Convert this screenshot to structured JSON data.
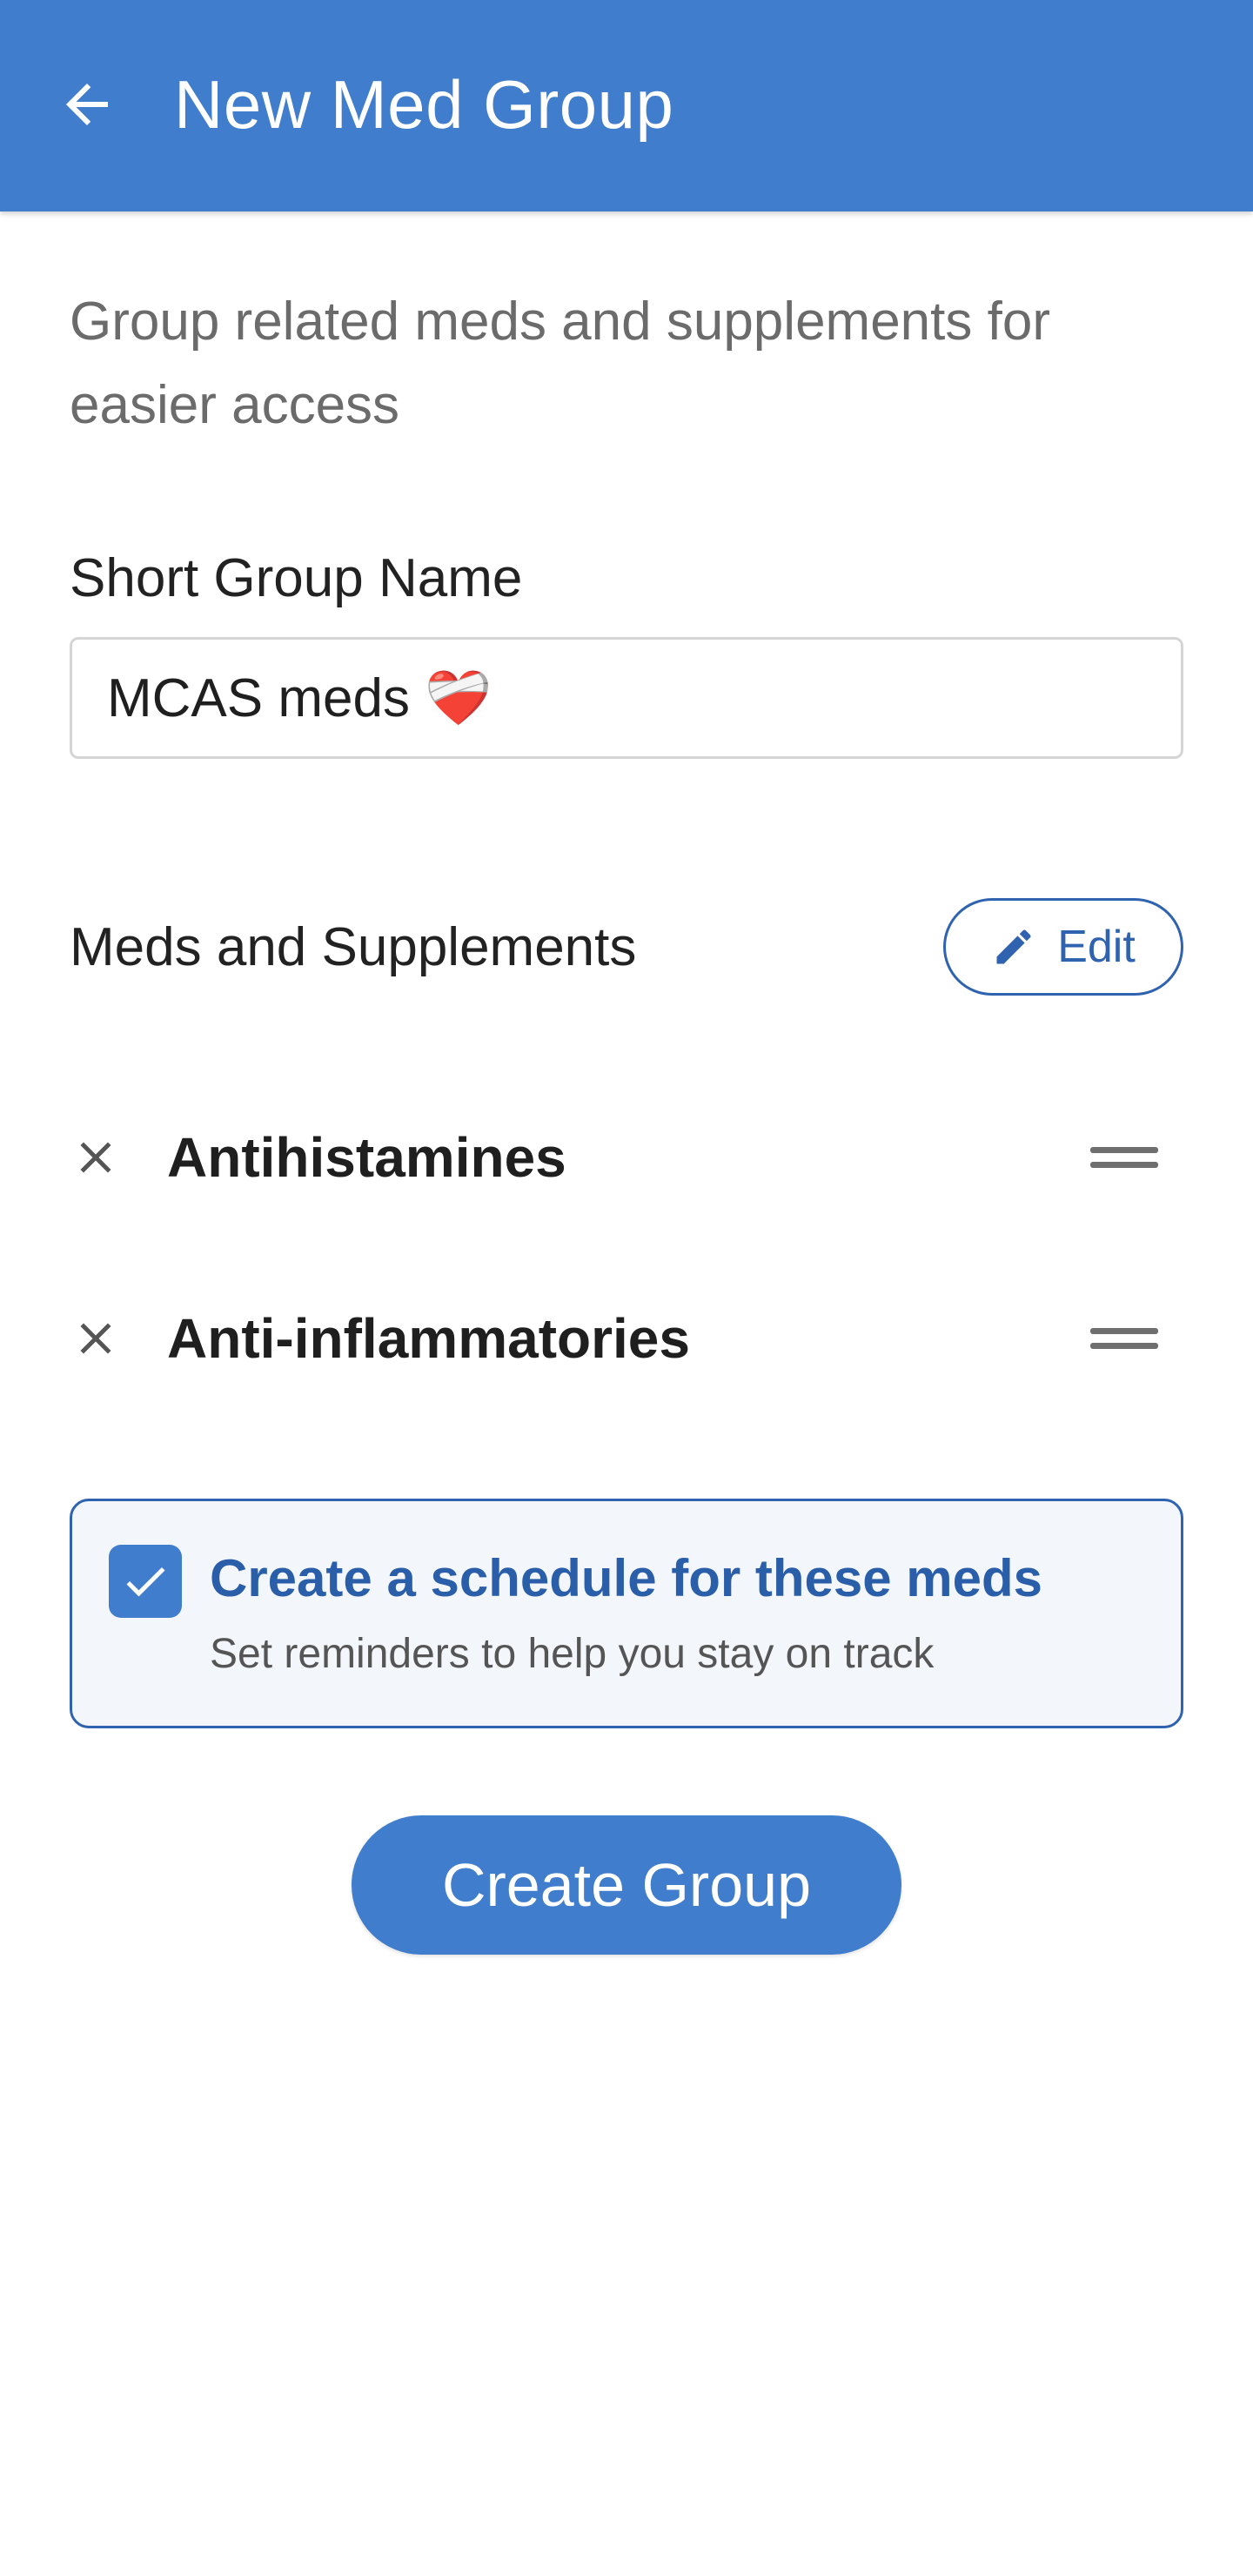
{
  "appbar": {
    "title": "New Med Group",
    "back_icon": "arrow-left-icon",
    "color": "#417dcd"
  },
  "subtitle": "Group related meds and supplements for easier access",
  "group_name": {
    "label": "Short Group Name",
    "value": "MCAS meds ❤️‍🩹"
  },
  "meds_section": {
    "title": "Meds and Supplements",
    "edit_label": "Edit",
    "edit_icon": "pencil-icon",
    "items": [
      {
        "label": "Antihistamines",
        "remove_icon": "close-icon",
        "handle_icon": "drag-handle-icon"
      },
      {
        "label": "Anti-inflammatories",
        "remove_icon": "close-icon",
        "handle_icon": "drag-handle-icon"
      }
    ]
  },
  "schedule": {
    "checked": true,
    "title": "Create a schedule for these meds",
    "subtitle": "Set reminders to help you stay on track",
    "accent": "#2a5ea8"
  },
  "create_button": {
    "label": "Create Group"
  }
}
